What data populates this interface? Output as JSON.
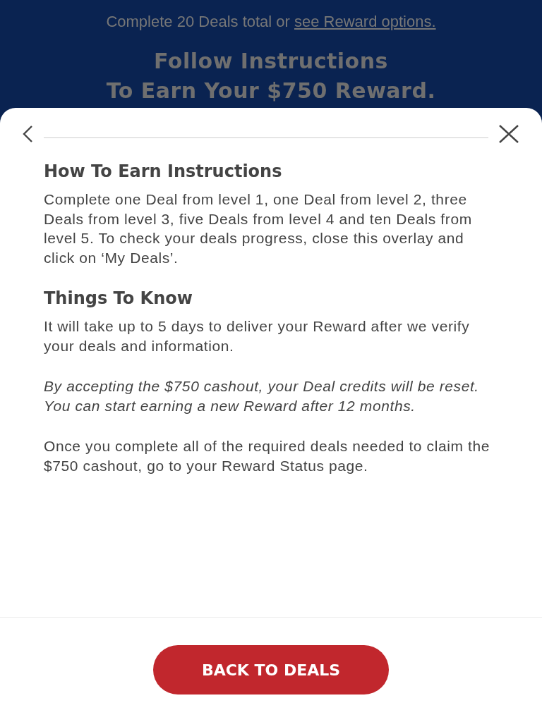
{
  "header": {
    "intro": "Complete 20 Deals total or",
    "link": "see Reward options.",
    "title_lines": [
      "Follow Instructions",
      "To Earn Your $750 Reward."
    ]
  },
  "sheet": {
    "sections": [
      {
        "heading": "How To Earn Instructions",
        "paragraphs": [
          {
            "kind": "normal",
            "text": "Complete one Deal from level 1, one Deal from level 2, three Deals from level 3, five Deals from level 4 and ten Deals from level 5. To check your deals progress, close this overlay and click on ‘My Deals’."
          }
        ]
      },
      {
        "heading": "Things To Know",
        "paragraphs": [
          {
            "kind": "normal",
            "text": "It will take up to 5 days to deliver your Reward after we verify your deals and information."
          },
          {
            "kind": "italic",
            "text": "By accepting the $750 cashout, your Deal credits will be reset. You can start earning a new Reward after 12 months."
          },
          {
            "kind": "normal",
            "text": "Once you complete all of the required deals needed to claim the $750 cashout, go to your Reward Status page."
          }
        ]
      }
    ],
    "button": "BACK TO DEALS"
  }
}
